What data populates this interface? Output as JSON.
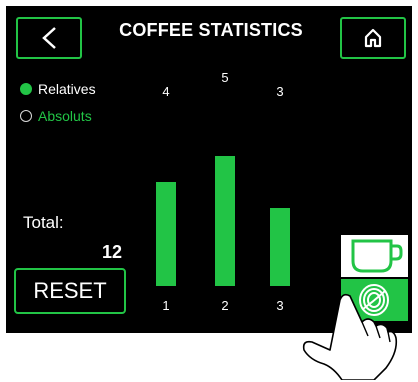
{
  "header": {
    "title": "COFFEE STATISTICS"
  },
  "mode": {
    "options": [
      {
        "label": "Relatives",
        "selected": true
      },
      {
        "label": "Absoluts",
        "selected": false
      }
    ]
  },
  "total": {
    "label": "Total:",
    "value": "12"
  },
  "reset": {
    "label": "RESET"
  },
  "icons": {
    "back": "chevron-left-icon",
    "home": "home-icon",
    "cup": "coffee-cup-icon",
    "beans": "coffee-beans-icon",
    "hand": "pointing-hand-icon"
  },
  "colors": {
    "accent": "#22c446",
    "background": "#000000",
    "text": "#ffffff"
  },
  "chart_data": {
    "type": "bar",
    "categories": [
      "1",
      "2",
      "3"
    ],
    "values": [
      4,
      5,
      3
    ],
    "data_labels": [
      "4",
      "5",
      "3"
    ]
  }
}
